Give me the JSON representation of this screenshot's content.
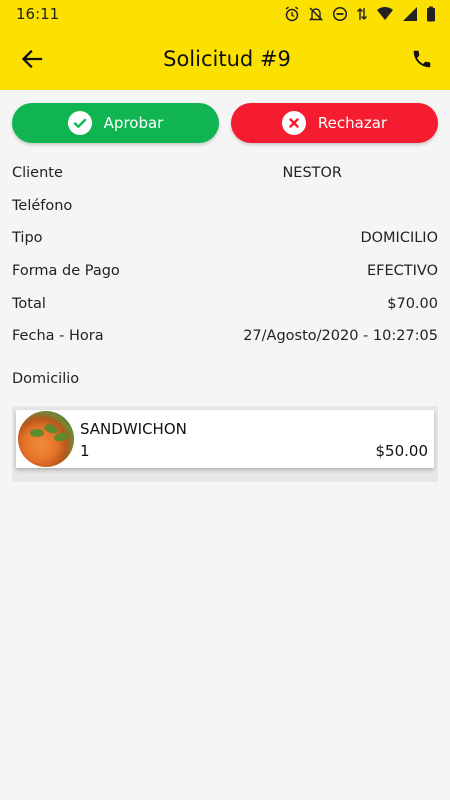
{
  "status_bar": {
    "time": "16:11"
  },
  "header": {
    "title": "Solicitud #9"
  },
  "actions": {
    "approve_label": "Aprobar",
    "reject_label": "Rechazar"
  },
  "details": [
    {
      "label": "Cliente",
      "value": "NESTOR"
    },
    {
      "label": "Teléfono",
      "value": ""
    },
    {
      "label": "Tipo",
      "value": "DOMICILIO"
    },
    {
      "label": "Forma de Pago",
      "value": "EFECTIVO"
    },
    {
      "label": "Total",
      "value": "$70.00"
    },
    {
      "label": "Fecha - Hora",
      "value": "27/Agosto/2020 - 10:27:05"
    }
  ],
  "address_label": "Domicilio",
  "products": [
    {
      "name": "SANDWICHON",
      "quantity": "1",
      "price": "$50.00"
    }
  ],
  "colors": {
    "app_bar": "#FCE100",
    "approve": "#10B552",
    "reject": "#F51C2F"
  }
}
